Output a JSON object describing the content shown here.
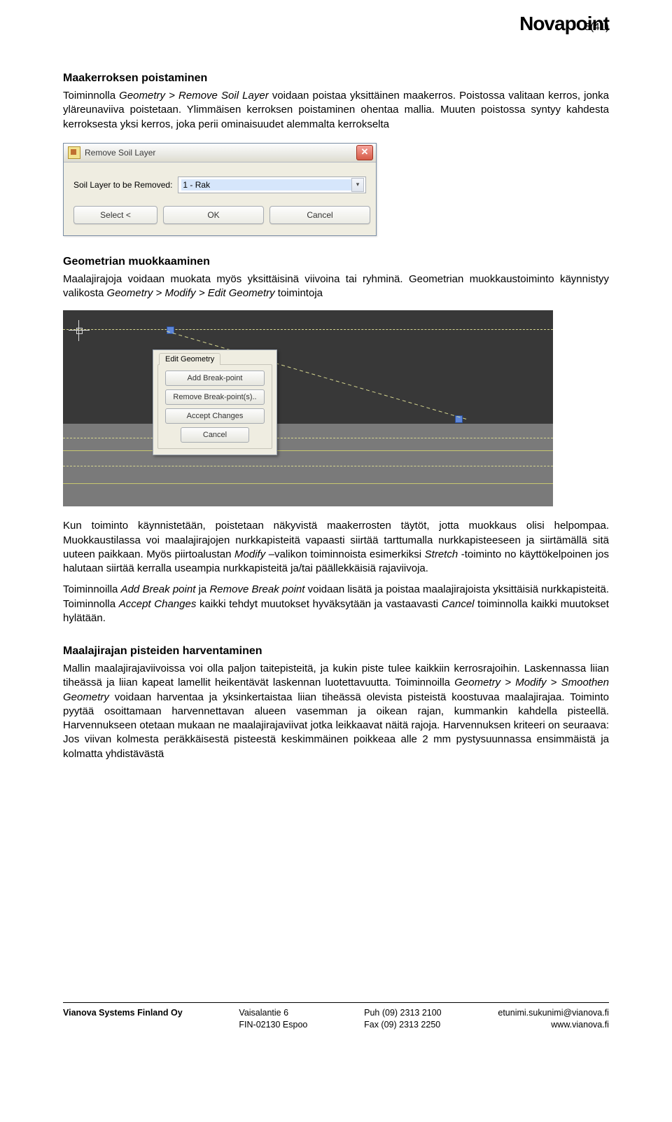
{
  "header": {
    "logo": "Novapoint",
    "page_number": "5(41)"
  },
  "s1": {
    "title": "Maakerroksen poistaminen",
    "p1a": "Toiminnolla ",
    "p1em": "Geometry > Remove Soil Layer",
    "p1b": " voidaan poistaa yksittäinen maakerros. Poistossa valitaan kerros, jonka yläreunaviiva poistetaan. Ylimmäisen kerroksen poistaminen ohentaa mallia. Muuten poistossa syntyy kahdesta kerroksesta yksi kerros, joka perii ominaisuudet alemmalta kerrokselta"
  },
  "dlg1": {
    "title": "Remove Soil Layer",
    "label": "Soil Layer to be Removed:",
    "value": "1 - Rak",
    "select": "Select <",
    "ok": "OK",
    "cancel": "Cancel"
  },
  "s2": {
    "title": "Geometrian muokkaaminen",
    "p1a": "Maalajirajoja voidaan muokata myös yksittäisinä viivoina tai ryhminä. Geometrian muokkaustoiminto käynnistyy valikosta ",
    "p1em": "Geometry > Modify > Edit Geometry",
    "p1b": " toimintoja"
  },
  "editdlg": {
    "tab": "Edit Geometry",
    "b1": "Add Break-point",
    "b2": "Remove Break-point(s)..",
    "b3": "Accept Changes",
    "b4": "Cancel"
  },
  "s2b": {
    "p2a": "Kun toiminto käynnistetään, poistetaan näkyvistä maakerrosten täytöt, jotta muokkaus olisi helpompaa. Muokkaustilassa voi maalajirajojen nurkkapisteitä vapaasti siirtää tarttumalla nurkkapisteeseen ja siirtämällä sitä uuteen paikkaan. Myös piirtoalustan ",
    "p2em1": "Modify",
    "p2b": " –valikon toiminnoista esimerkiksi ",
    "p2em2": "Stretch",
    "p2c": " -toiminto no käyttökelpoinen jos halutaan siirtää kerralla useampia nurkkapisteitä ja/tai päällekkäisiä rajaviivoja.",
    "p3a": "Toiminnoilla ",
    "p3em1": "Add Break point",
    "p3b": " ja ",
    "p3em2": "Remove Break point",
    "p3c": " voidaan lisätä ja poistaa maalajirajoista yksittäisiä nurkkapisteitä. Toiminnolla ",
    "p3em3": "Accept Changes",
    "p3d": " kaikki tehdyt muutokset hyväksytään ja vastaavasti ",
    "p3em4": "Cancel",
    "p3e": " toiminnolla kaikki muutokset hylätään."
  },
  "s3": {
    "title": "Maalajirajan pisteiden harventaminen",
    "p1a": "Mallin maalajirajaviivoissa voi olla paljon taitepisteitä, ja kukin piste tulee kaikkiin kerrosrajoihin. Laskennassa liian tiheässä ja liian kapeat lamellit heikentävät laskennan luotettavuutta. Toiminnoilla ",
    "p1em": "Geometry > Modify > Smoothen Geometry",
    "p1b": " voidaan harventaa ja yksinkertaistaa liian tiheässä olevista pisteistä koostuvaa maalajirajaa. Toiminto pyytää osoittamaan harvennettavan alueen vasemman ja oikean rajan, kummankin kahdella pisteellä. Harvennukseen otetaan mukaan ne maalajirajaviivat jotka leikkaavat näitä rajoja. Harvennuksen kriteeri on seuraava: Jos viivan kolmesta peräkkäisestä pisteestä keskimmäinen poikkeaa alle 2 mm pystysuunnassa ensimmäistä ja kolmatta yhdistävästä"
  },
  "footer": {
    "c1": "Vianova Systems Finland Oy",
    "c2": "Vaisalantie 6\nFIN-02130 Espoo",
    "c3": "Puh  (09) 2313 2100\nFax  (09) 2313 2250",
    "c4": "etunimi.sukunimi@vianova.fi\nwww.vianova.fi"
  }
}
